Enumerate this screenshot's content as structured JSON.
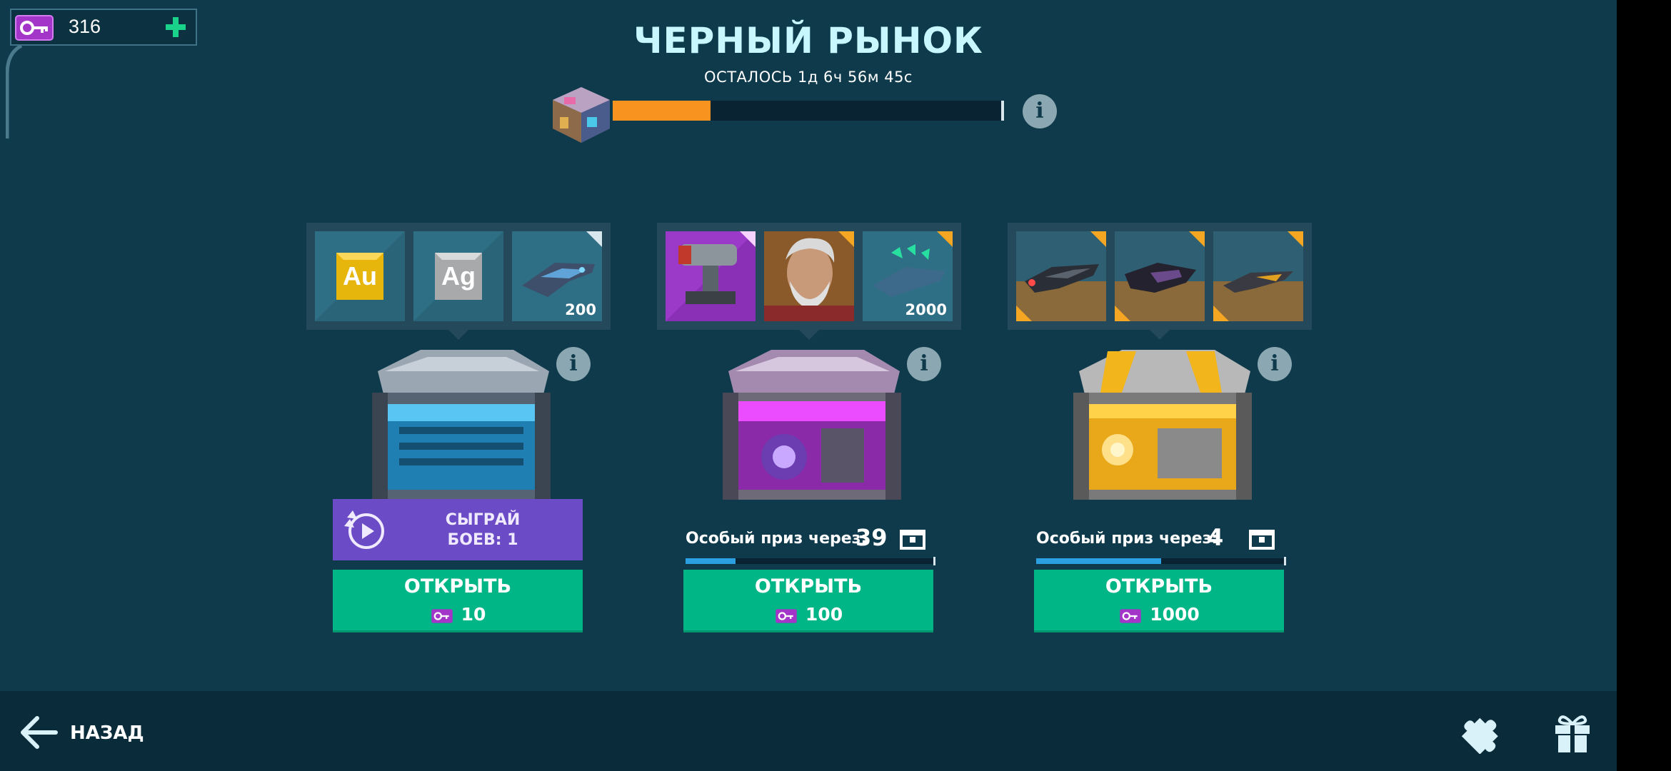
{
  "header": {
    "keys_count": "316",
    "title": "ЧЕРНЫЙ РЫНОК",
    "timer": "ОСТАЛОСЬ 1д 6ч 56м 45с",
    "progress_fraction": 0.25
  },
  "cards": [
    {
      "rewards": [
        {
          "icon": "gold-au-icon",
          "text": "Au"
        },
        {
          "icon": "silver-ag-icon",
          "text": "Ag"
        },
        {
          "icon": "ship-icon",
          "count": "200"
        }
      ],
      "play": {
        "line1": "СЫГРАЙ",
        "line2": "БОЕВ: 1"
      },
      "open_label": "ОТКРЫТЬ",
      "price": "10",
      "chest_color": "#2ea8e0"
    },
    {
      "rewards": [
        {
          "icon": "turret-icon"
        },
        {
          "icon": "commander-portrait-icon"
        },
        {
          "icon": "ship-icon",
          "count": "2000"
        }
      ],
      "special": {
        "label": "Особый приз через:",
        "count": "39",
        "fraction": 0.2
      },
      "open_label": "ОТКРЫТЬ",
      "price": "100",
      "chest_color": "#c026d3"
    },
    {
      "rewards": [
        {
          "icon": "ship-icon"
        },
        {
          "icon": "ship-icon"
        },
        {
          "icon": "ship-icon"
        }
      ],
      "special": {
        "label": "Особый приз через:",
        "count": "4",
        "fraction": 0.5
      },
      "open_label": "ОТКРЫТЬ",
      "price": "1000",
      "chest_color": "#f2b51c"
    }
  ],
  "footer": {
    "back_label": "НАЗАД"
  },
  "colors": {
    "background": "#0e3a4b",
    "accent_green": "#00b586",
    "accent_orange": "#f7931e",
    "play_purple": "#6c4cc6"
  }
}
